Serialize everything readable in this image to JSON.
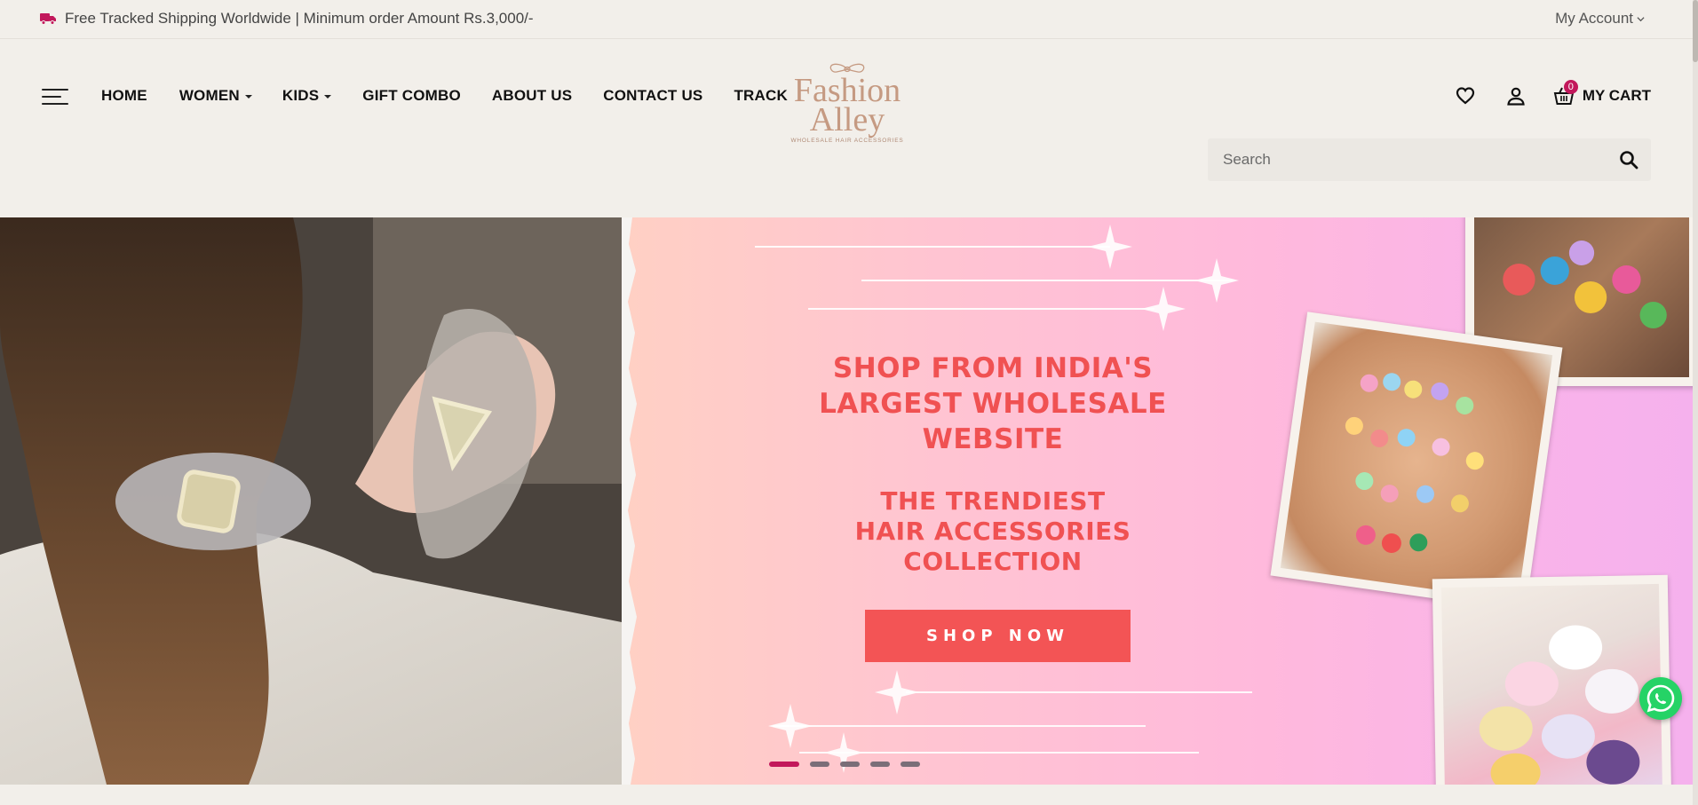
{
  "topbar": {
    "announcement": "Free Tracked Shipping Worldwide | Minimum order Amount Rs.3,000/-",
    "account_label": "My Account",
    "truck_icon": "truck-icon"
  },
  "nav": {
    "items": [
      {
        "label": "HOME",
        "has_dropdown": false
      },
      {
        "label": "WOMEN",
        "has_dropdown": true
      },
      {
        "label": "KIDS",
        "has_dropdown": true
      },
      {
        "label": "GIFT COMBO",
        "has_dropdown": false
      },
      {
        "label": "ABOUT US",
        "has_dropdown": false
      },
      {
        "label": "CONTACT US",
        "has_dropdown": false
      },
      {
        "label": "TRACK",
        "has_dropdown": false
      }
    ]
  },
  "logo": {
    "line1": "Fashion",
    "line2": "Alley",
    "tagline": "WHOLESALE HAIR ACCESSORIES",
    "color": "#c59a82"
  },
  "header": {
    "cart_label": "MY CART",
    "cart_count": "0",
    "badge_color": "#c2185b"
  },
  "search": {
    "placeholder": "Search"
  },
  "hero": {
    "headline": [
      "SHOP FROM INDIA'S",
      "LARGEST WHOLESALE",
      "WEBSITE"
    ],
    "subline": [
      "THE TRENDIEST",
      "HAIR ACCESSORIES",
      "COLLECTION"
    ],
    "cta_label": "SHOP NOW",
    "accent_color": "#f05152",
    "slide_count": 5,
    "active_slide": 0
  }
}
